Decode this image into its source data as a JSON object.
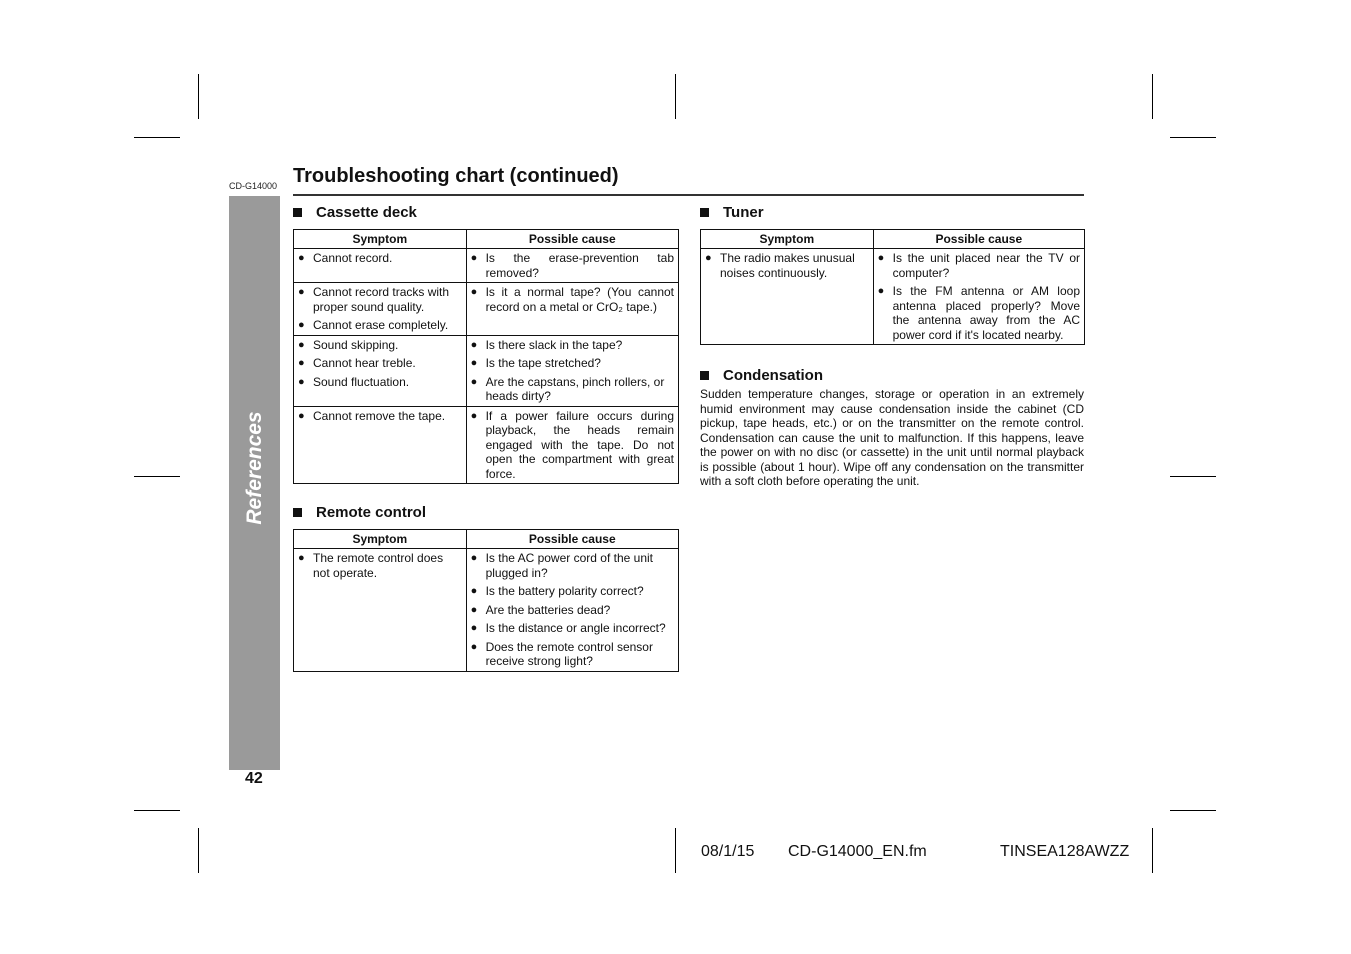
{
  "header": {
    "model_tag": "CD-G14000",
    "title": "Troubleshooting chart (continued)"
  },
  "sidebar": {
    "label": "References",
    "page_number": "42"
  },
  "columns": {
    "symptom": "Symptom",
    "cause": "Possible cause"
  },
  "cassette": {
    "heading": "Cassette deck",
    "rows": [
      {
        "symptoms": [
          "Cannot record."
        ],
        "causes": [
          "Is the erase-prevention tab removed?"
        ]
      },
      {
        "symptoms": [
          "Cannot record tracks with proper sound quality.",
          "Cannot erase completely."
        ],
        "causes": [
          "Is it a normal tape? (You cannot record on a metal or CrO₂ tape.)"
        ]
      },
      {
        "symptoms": [
          "Sound skipping.",
          "Cannot hear treble.",
          "Sound fluctuation."
        ],
        "causes": [
          "Is there slack in the tape?",
          "Is the tape stretched?",
          "Are the capstans, pinch rollers, or heads dirty?"
        ]
      },
      {
        "symptoms": [
          "Cannot remove the tape."
        ],
        "causes": [
          "If a power failure occurs during playback, the heads remain engaged with the tape. Do not open the compartment with great force."
        ]
      }
    ]
  },
  "remote": {
    "heading": "Remote control",
    "rows": [
      {
        "symptoms": [
          "The remote control does not operate."
        ],
        "causes": [
          "Is the AC power cord of the unit plugged in?",
          "Is the battery polarity correct?",
          "Are the batteries dead?",
          "Is the distance or angle incorrect?",
          "Does the remote control sensor receive strong light?"
        ]
      }
    ]
  },
  "tuner": {
    "heading": "Tuner",
    "rows": [
      {
        "symptoms": [
          "The radio makes unusual noises continuously."
        ],
        "causes": [
          "Is the unit placed near the TV or computer?",
          "Is the FM antenna or AM loop antenna placed properly? Move the antenna away from the AC power cord if it's located nearby."
        ]
      }
    ]
  },
  "condensation": {
    "heading": "Condensation",
    "text": "Sudden temperature changes, storage or operation in an extremely humid environment may cause condensation inside the cabinet (CD pickup, tape heads, etc.) or on the transmitter on the remote control. Condensation can cause the unit to malfunction. If this happens, leave the power on with no disc (or cassette) in the unit until normal playback is possible (about 1 hour). Wipe off any condensation on the transmitter with a soft cloth before operating the unit."
  },
  "footer": {
    "date": "08/1/15",
    "file": "CD-G14000_EN.fm",
    "code": "TINSEA128AWZZ"
  },
  "bullet_glyph": "●"
}
